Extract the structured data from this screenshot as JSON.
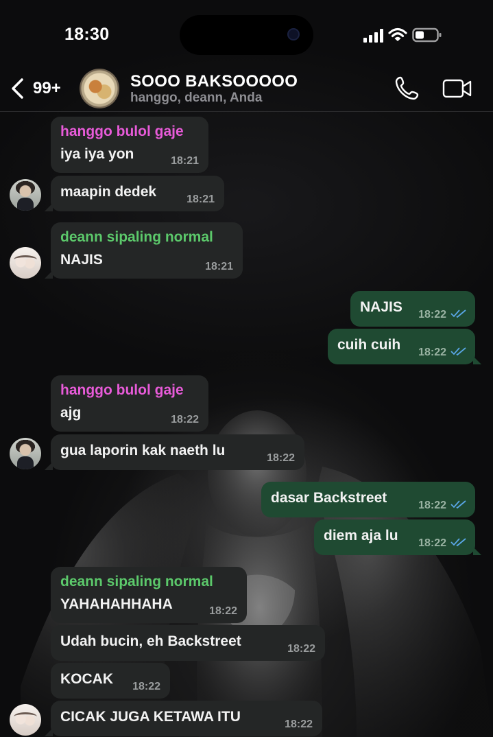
{
  "status_bar": {
    "time": "18:30"
  },
  "header": {
    "unread_count": "99+",
    "group_name": "SOOO BAKSOOOOO",
    "members": "hanggo, deann, Anda"
  },
  "colors": {
    "incoming_bubble": "#242626",
    "outgoing_bubble": "#1f4a32",
    "sender_hanggo": "#e85bd9",
    "sender_deann": "#5cc96b",
    "read_ticks": "#5aa7e8"
  },
  "messages": [
    {
      "direction": "in",
      "sender": "hanggo bulol gaje",
      "text": "iya iya yon",
      "time": "18:21"
    },
    {
      "direction": "in",
      "sender": "",
      "text": "maapin dedek",
      "time": "18:21"
    },
    {
      "direction": "in",
      "sender": "deann sipaling normal",
      "text": "NAJIS",
      "time": "18:21"
    },
    {
      "direction": "out",
      "text": "NAJIS",
      "time": "18:22"
    },
    {
      "direction": "out",
      "text": "cuih cuih",
      "time": "18:22"
    },
    {
      "direction": "in",
      "sender": "hanggo bulol gaje",
      "text": "ajg",
      "time": "18:22"
    },
    {
      "direction": "in",
      "sender": "",
      "text": "gua laporin kak naeth lu",
      "time": "18:22"
    },
    {
      "direction": "out",
      "text": "dasar Backstreet",
      "time": "18:22"
    },
    {
      "direction": "out",
      "text": "diem aja lu",
      "time": "18:22"
    },
    {
      "direction": "in",
      "sender": "deann sipaling normal",
      "text": "YAHAHAHHAHA",
      "time": "18:22"
    },
    {
      "direction": "in",
      "sender": "",
      "text": "Udah bucin, eh Backstreet",
      "time": "18:22"
    },
    {
      "direction": "in",
      "sender": "",
      "text": "KOCAK",
      "time": "18:22"
    },
    {
      "direction": "in",
      "sender": "",
      "text": "CICAK JUGA KETAWA ITU",
      "time": "18:22"
    }
  ]
}
